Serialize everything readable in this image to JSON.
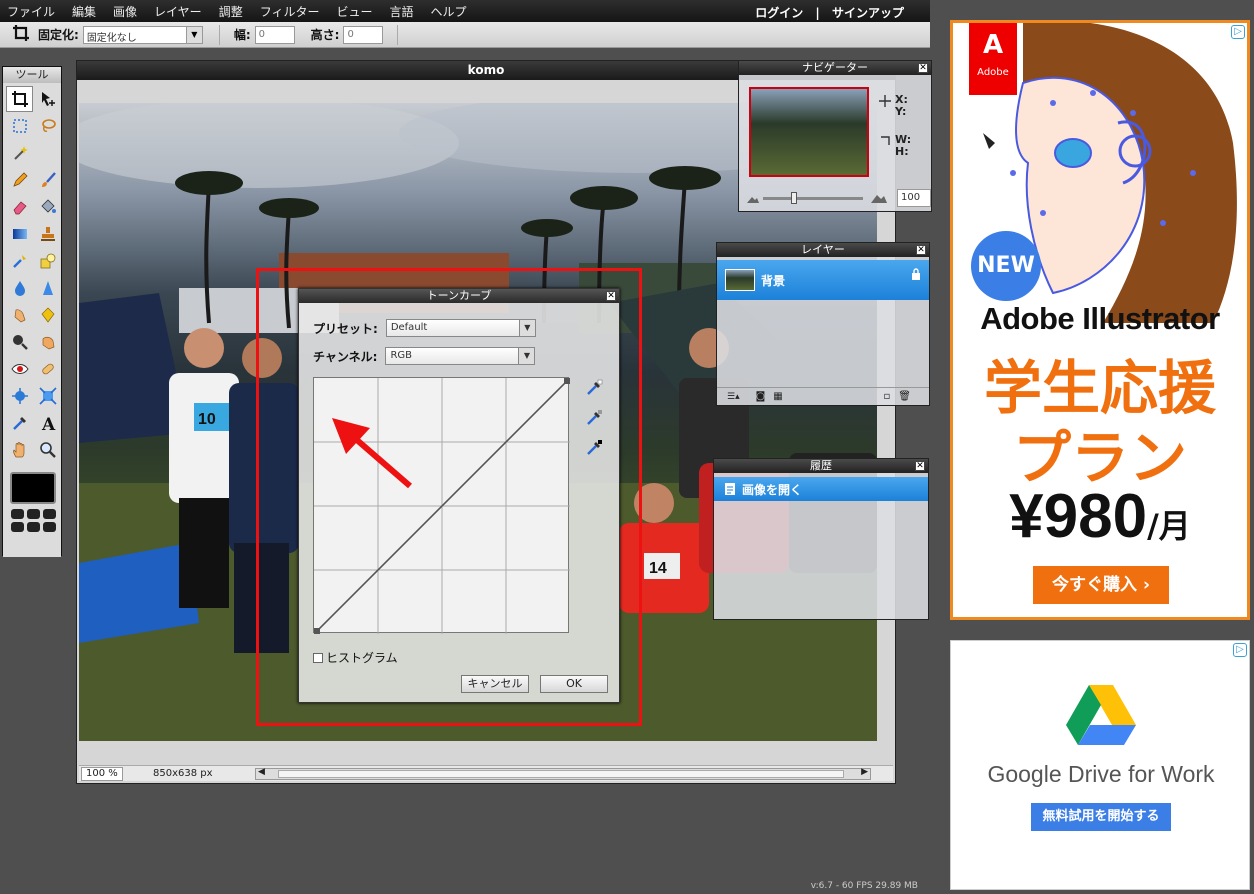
{
  "menu": {
    "items": [
      "ファイル",
      "編集",
      "画像",
      "レイヤー",
      "調整",
      "フィルター",
      "ビュー",
      "言語",
      "ヘルプ"
    ],
    "login": "ログイン",
    "divider": "|",
    "signup": "サインアップ"
  },
  "options": {
    "fixed_label": "固定化:",
    "fixed_value": "固定化なし",
    "width_label": "幅:",
    "width_value": "0",
    "height_label": "高さ:",
    "height_value": "0"
  },
  "tools": {
    "title": "ツール"
  },
  "document": {
    "title": "komo",
    "zoom": "100",
    "zoom_unit": "%",
    "size": "850x638 px"
  },
  "navigator": {
    "title": "ナビゲーター",
    "x_label": "X:",
    "y_label": "Y:",
    "w_label": "W:",
    "h_label": "H:",
    "zoom_value": "100",
    "slider_level": 0.3
  },
  "layers": {
    "title": "レイヤー",
    "items": [
      {
        "name": "背景"
      }
    ]
  },
  "history": {
    "title": "履歴",
    "items": [
      {
        "name": "画像を開く"
      }
    ]
  },
  "dialog": {
    "title": "トーンカーブ",
    "preset_label": "プリセット:",
    "preset_value": "Default",
    "channel_label": "チャンネル:",
    "channel_value": "RGB",
    "histogram_label": "ヒストグラム",
    "cancel_label": "キャンセル",
    "ok_label": "OK"
  },
  "ad1": {
    "brand": "Adobe",
    "badge": "NEW",
    "product": "Adobe Illustrator",
    "headline1": "学生応援",
    "headline2": "プラン",
    "price": "¥980",
    "price_unit": "/月",
    "cta": "今すぐ購入 ›"
  },
  "ad2": {
    "product": "Google Drive for Work",
    "cta": "無料試用を開始する"
  },
  "footer": {
    "status": "v:6.7 - 60 FPS 29.89 MB"
  },
  "colors": {
    "accent": "#1c81d9",
    "highlight": "#e11111",
    "ad_orange": "#f08a20",
    "google_blue": "#3b7ee6"
  }
}
